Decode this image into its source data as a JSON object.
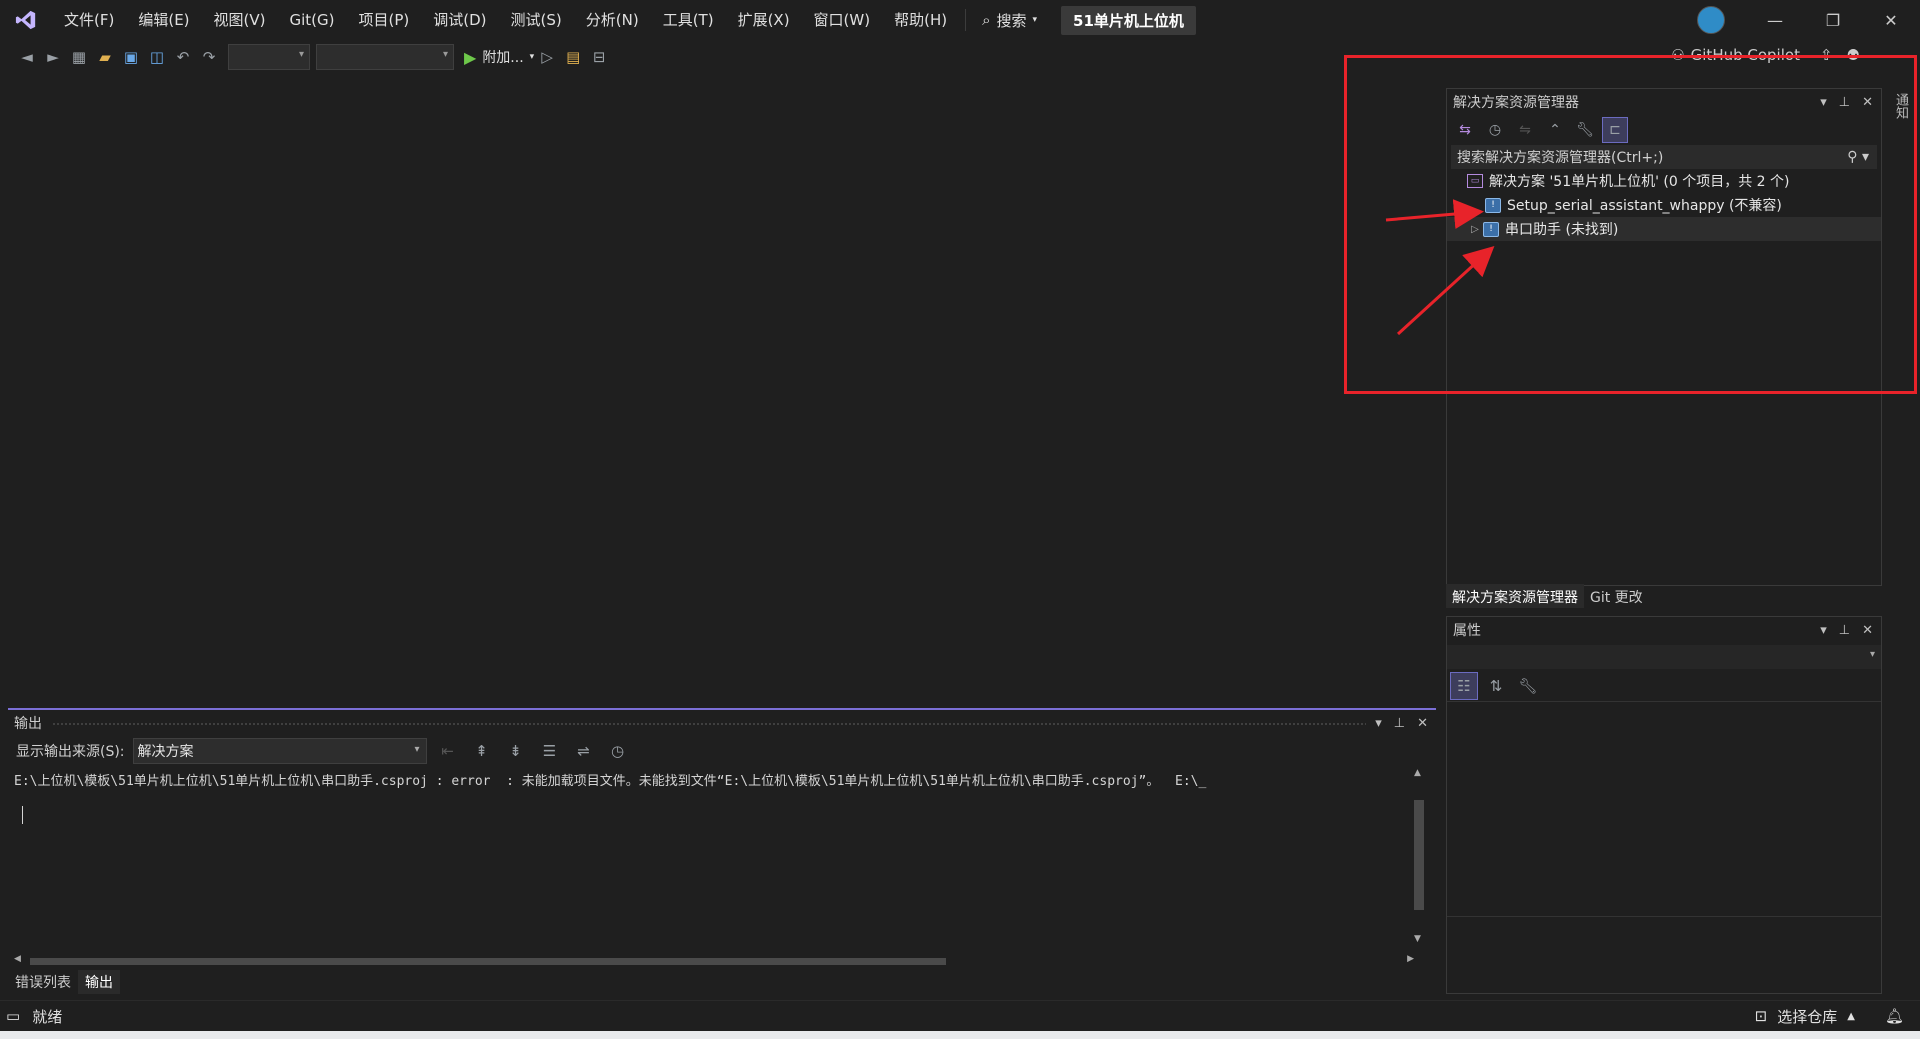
{
  "menu": {
    "items": [
      "文件(F)",
      "编辑(E)",
      "视图(V)",
      "Git(G)",
      "项目(P)",
      "调试(D)",
      "测试(S)",
      "分析(N)",
      "工具(T)",
      "扩展(X)",
      "窗口(W)",
      "帮助(H)"
    ],
    "search_label": "搜索",
    "solution_name": "51单片机上位机"
  },
  "toolbar": {
    "run_label": "附加...",
    "copilot_label": "GitHub Copilot"
  },
  "notifications_tab": "通知",
  "solution_explorer": {
    "title": "解决方案资源管理器",
    "search_placeholder": "搜索解决方案资源管理器(Ctrl+;)",
    "tree": [
      {
        "label": "解决方案 '51单片机上位机' (0 个项目，共 2 个)",
        "type": "solution"
      },
      {
        "label": "Setup_serial_assistant_whappy (不兼容)",
        "type": "project"
      },
      {
        "label": "串口助手 (未找到)",
        "type": "project"
      }
    ],
    "tabs": [
      "解决方案资源管理器",
      "Git 更改"
    ]
  },
  "properties": {
    "title": "属性"
  },
  "output": {
    "title": "输出",
    "source_label": "显示输出来源(S):",
    "source_value": "解决方案",
    "text": "E:\\上位机\\模板\\51单片机上位机\\51单片机上位机\\串口助手.csproj : error  : 未能加载项目文件。未能找到文件“E:\\上位机\\模板\\51单片机上位机\\51单片机上位机\\串口助手.csproj”。  E:\\_"
  },
  "bottom_tabs": [
    "错误列表",
    "输出"
  ],
  "status": {
    "left": "就绪",
    "right": "选择仓库"
  },
  "colors": {
    "background": "#1f1f1f",
    "accent": "#7b6fd6",
    "annotation": "#e8232a"
  }
}
